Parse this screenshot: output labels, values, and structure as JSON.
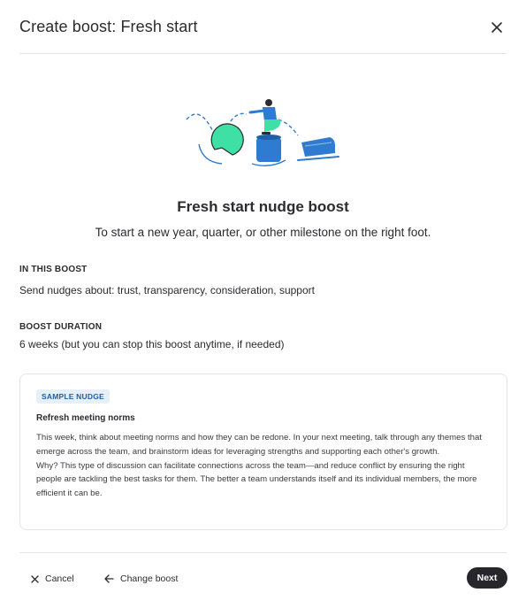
{
  "header": {
    "title": "Create boost: Fresh start"
  },
  "boost": {
    "title": "Fresh start nudge boost",
    "description": "To start a new year, quarter, or other milestone on the right foot."
  },
  "in_this_boost": {
    "heading": "IN THIS BOOST",
    "text": "Send nudges about: trust, transparency, consideration, support"
  },
  "duration": {
    "heading": "BOOST DURATION",
    "text": "6 weeks (but you can stop this boost anytime, if needed)"
  },
  "sample": {
    "badge": "SAMPLE NUDGE",
    "title": "Refresh meeting norms",
    "paragraph1": "This week, think about meeting norms and how they can be redone. In your next meeting, talk through any themes that emerge across the team, and brainstorm ideas for leveraging strengths and supporting each other's growth.",
    "paragraph2": "Why? This type of discussion can facilitate connections across the team—and reduce conflict by ensuring the right people are tackling the best tasks for them. The better a team understands itself and its individual members, the more efficient it can be."
  },
  "footer": {
    "cancel_label": "Cancel",
    "change_label": "Change boost",
    "next_label": "Next"
  },
  "colors": {
    "accent_blue": "#2f7bd1",
    "accent_green": "#3fe0a6",
    "primary_button": "#26262b",
    "badge_bg": "#e6f0fb",
    "badge_text": "#1f5fa8"
  },
  "icons": {
    "close": "close-icon",
    "cancel": "close-icon",
    "back": "arrow-left-icon"
  }
}
